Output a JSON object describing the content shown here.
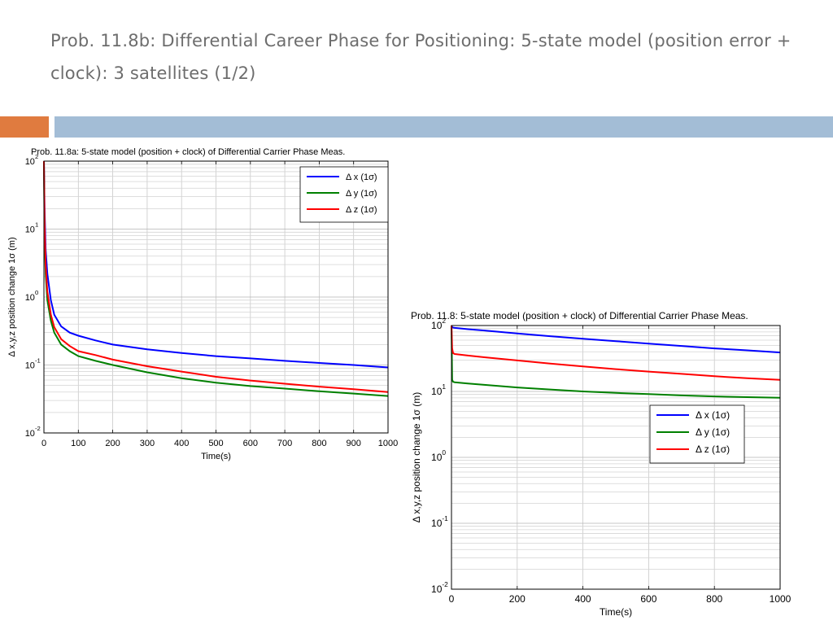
{
  "slide": {
    "title": "Prob. 11.8b: Differential Career Phase for Positioning: 5-state model (position error + clock): 3 satellites (1/2)",
    "accent_orange": "#e07b3f",
    "accent_blue": "#a3bdd6"
  },
  "chart_data": [
    {
      "type": "line",
      "title": "Prob. 11.8a: 5-state model (position + clock) of Differential Carrier Phase Meas.",
      "xlabel": "Time(s)",
      "ylabel": "Δ x,y,z position change 1σ (m)",
      "xlim": [
        0,
        1000
      ],
      "ylim": [
        0.01,
        100
      ],
      "yscale": "log",
      "grid": true,
      "legend_position": "top-right",
      "xticks": [
        0,
        100,
        200,
        300,
        400,
        500,
        600,
        700,
        800,
        900,
        1000
      ],
      "yticks": [
        {
          "base": "10",
          "exp": "-2"
        },
        {
          "base": "10",
          "exp": "-1"
        },
        {
          "base": "10",
          "exp": "0"
        },
        {
          "base": "10",
          "exp": "1"
        },
        {
          "base": "10",
          "exp": "2"
        }
      ],
      "x": [
        0,
        2,
        5,
        10,
        20,
        30,
        50,
        75,
        100,
        150,
        200,
        300,
        400,
        500,
        600,
        700,
        800,
        900,
        1000
      ],
      "series": [
        {
          "name": "Δ x (1σ)",
          "color": "#0000ff",
          "values": [
            100,
            20,
            5.0,
            2.2,
            0.9,
            0.55,
            0.37,
            0.3,
            0.27,
            0.23,
            0.2,
            0.17,
            0.15,
            0.135,
            0.125,
            0.115,
            0.107,
            0.1,
            0.092
          ]
        },
        {
          "name": "Δ y (1σ)",
          "color": "#008000",
          "values": [
            100,
            8.0,
            2.2,
            0.9,
            0.45,
            0.3,
            0.2,
            0.16,
            0.135,
            0.115,
            0.1,
            0.078,
            0.064,
            0.055,
            0.049,
            0.045,
            0.041,
            0.038,
            0.035
          ]
        },
        {
          "name": "Δ z (1σ)",
          "color": "#ff0000",
          "values": [
            100,
            12.0,
            3.0,
            1.2,
            0.55,
            0.36,
            0.24,
            0.19,
            0.16,
            0.14,
            0.12,
            0.096,
            0.08,
            0.067,
            0.059,
            0.053,
            0.048,
            0.044,
            0.04
          ]
        }
      ]
    },
    {
      "type": "line",
      "title": "Prob. 11.8: 5-state model (position + clock) of Differential Carrier Phase Meas.",
      "xlabel": "Time(s)",
      "ylabel": "Δ x,y,z position change 1σ (m)",
      "xlim": [
        0,
        1000
      ],
      "ylim": [
        0.01,
        100
      ],
      "yscale": "log",
      "grid": true,
      "legend_position": "middle-right",
      "xticks": [
        0,
        200,
        400,
        600,
        800,
        1000
      ],
      "yticks": [
        {
          "base": "10",
          "exp": "-2"
        },
        {
          "base": "10",
          "exp": "-1"
        },
        {
          "base": "10",
          "exp": "0"
        },
        {
          "base": "10",
          "exp": "1"
        },
        {
          "base": "10",
          "exp": "2"
        }
      ],
      "x": [
        0,
        2,
        5,
        10,
        50,
        100,
        200,
        300,
        400,
        500,
        600,
        700,
        800,
        900,
        1000
      ],
      "series": [
        {
          "name": "Δ x (1σ)",
          "color": "#0000ff",
          "values": [
            100,
            95,
            93,
            92,
            88,
            84,
            76,
            69,
            63,
            58,
            53,
            49,
            45,
            42,
            39
          ]
        },
        {
          "name": "Δ y (1σ)",
          "color": "#008000",
          "values": [
            100,
            15,
            14,
            13.8,
            13.2,
            12.6,
            11.5,
            10.7,
            10.0,
            9.5,
            9.1,
            8.7,
            8.4,
            8.2,
            8.0
          ]
        },
        {
          "name": "Δ z (1σ)",
          "color": "#ff0000",
          "values": [
            100,
            45,
            38,
            37,
            35,
            33,
            29.5,
            26.5,
            24,
            21.8,
            20,
            18.5,
            17,
            15.9,
            15
          ]
        }
      ]
    }
  ]
}
